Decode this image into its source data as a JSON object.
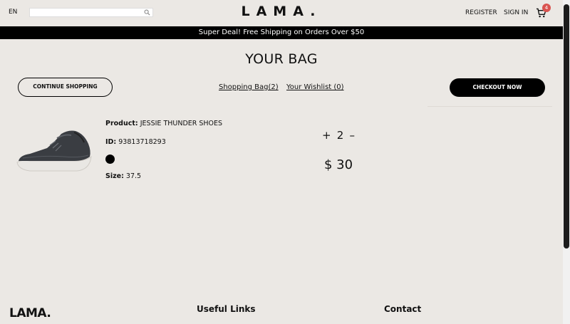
{
  "navbar": {
    "language": "EN",
    "search": {
      "placeholder": ""
    },
    "logo": "LAMA.",
    "register_label": "REGISTER",
    "signin_label": "SIGN IN",
    "cart_count": "4",
    "cart_icon": "shopping-cart-icon",
    "search_icon": "search-icon"
  },
  "announcement": "Super Deal! Free Shipping on Orders Over $50",
  "page_title": "YOUR BAG",
  "actions": {
    "continue_label": "CONTINUE SHOPPING",
    "shopping_bag_label": "Shopping Bag(2)",
    "wishlist_label": "Your Wishlist (0)",
    "checkout_label": "CHECKOUT NOW"
  },
  "cart": {
    "items": [
      {
        "product_label": "Product:",
        "product_name": "JESSIE THUNDER SHOES",
        "id_label": "ID:",
        "id_value": "93813718293",
        "color": "#000000",
        "size_label": "Size:",
        "size_value": "37.5",
        "qty_plus": "+",
        "quantity": "2",
        "qty_minus": "–",
        "price": "$ 30"
      }
    ]
  },
  "footer": {
    "logo": "LAMA.",
    "useful_links_heading": "Useful Links",
    "contact_heading": "Contact"
  }
}
